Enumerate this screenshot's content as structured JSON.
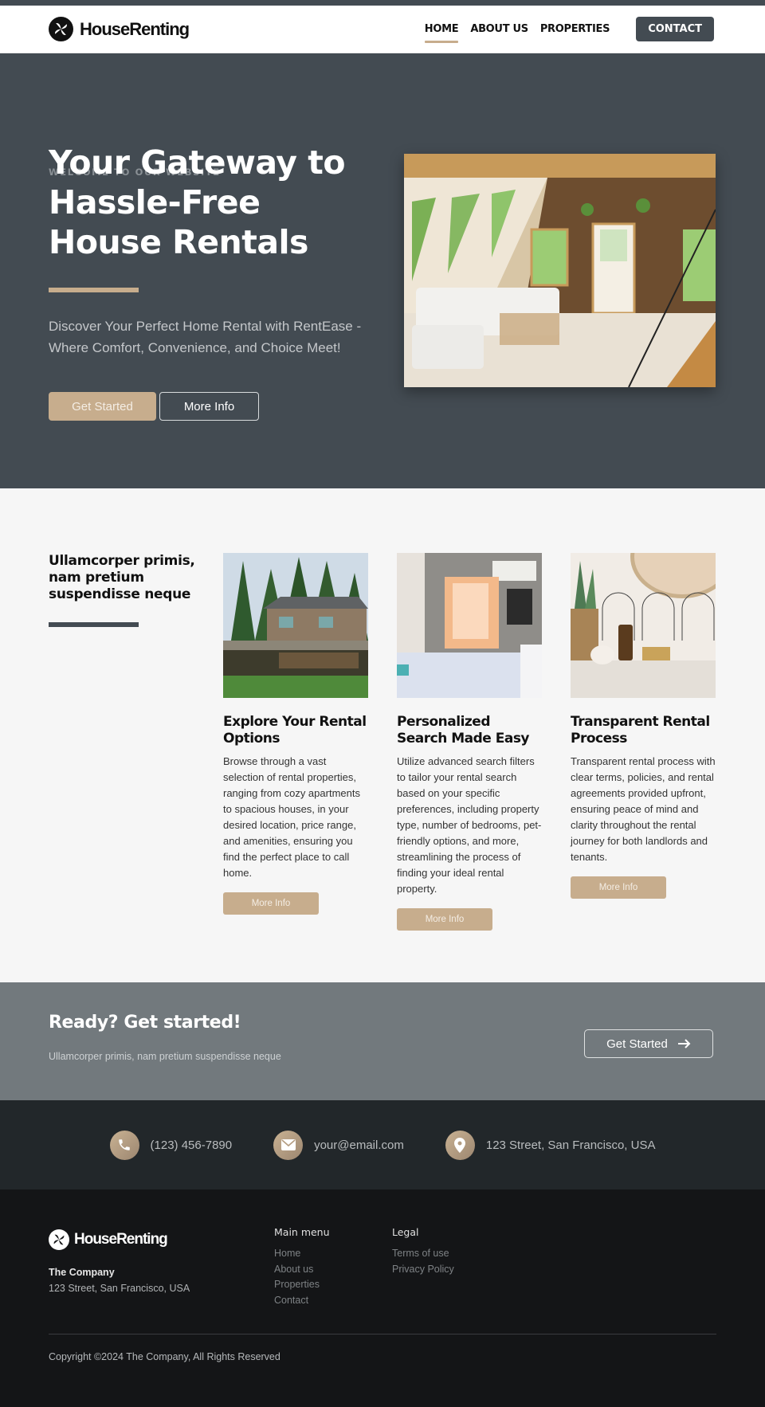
{
  "brand": {
    "name": "HouseRenting",
    "accent_color": "#c7ad8d",
    "dark_color": "#434b52"
  },
  "header": {
    "nav": [
      {
        "label": "HOME",
        "active": true
      },
      {
        "label": "ABOUT US",
        "active": false
      },
      {
        "label": "PROPERTIES",
        "active": false
      }
    ],
    "contact_label": "CONTACT"
  },
  "hero": {
    "eyebrow": "WELCOME TO OUR WEBSITE",
    "title": "Your Gateway to Hassle-Free House Rentals",
    "subtitle": "Discover Your Perfect Home Rental with RentEase - Where Comfort, Convenience, and Choice Meet!",
    "primary_button": "Get Started",
    "secondary_button": "More Info",
    "image_alt": "Bright A-frame cabin living room with white sofa and plants"
  },
  "features": {
    "heading": "Ullamcorper primis, nam pretium suspendisse neque",
    "cards": [
      {
        "title": "Explore Your Rental Options",
        "text": "Browse through a vast selection of rental properties, ranging from cozy apartments to spacious houses, in your desired location, price range, and amenities, ensuring you find the perfect place to call home.",
        "button": "More Info",
        "image_alt": "Lakeside cabin surrounded by pine trees"
      },
      {
        "title": "Personalized Search Made Easy",
        "text": "Utilize advanced search filters to tailor your rental search based on your specific preferences, including property type, number of bedrooms, pet-friendly options, and more, streamlining the process of finding your ideal rental property.",
        "button": "More Info",
        "image_alt": "Bedroom with orange curtains"
      },
      {
        "title": "Transparent Rental Process",
        "text": "Transparent rental process with clear terms, policies, and rental agreements provided upfront, ensuring peace of mind and clarity throughout the rental journey for both landlords and tenants.",
        "button": "More Info",
        "image_alt": "Bathroom vanity with brass faucet"
      }
    ]
  },
  "cta": {
    "title": "Ready? Get started!",
    "subtitle": "Ullamcorper primis, nam pretium suspendisse neque",
    "button": "Get Started",
    "button_icon": "arrow-right-icon"
  },
  "contact": {
    "phone": "(123) 456-7890",
    "email": "your@email.com",
    "address": "123 Street, San Francisco, USA"
  },
  "footer": {
    "company": "The Company",
    "address": "123 Street, San Francisco, USA",
    "main_menu": {
      "title": "Main menu",
      "links": [
        "Home",
        "About us",
        "Properties",
        "Contact"
      ]
    },
    "legal": {
      "title": "Legal",
      "links": [
        "Terms of use",
        "Privacy Policy"
      ]
    },
    "copyright": "Copyright ©2024 The Company, All Rights Reserved"
  }
}
